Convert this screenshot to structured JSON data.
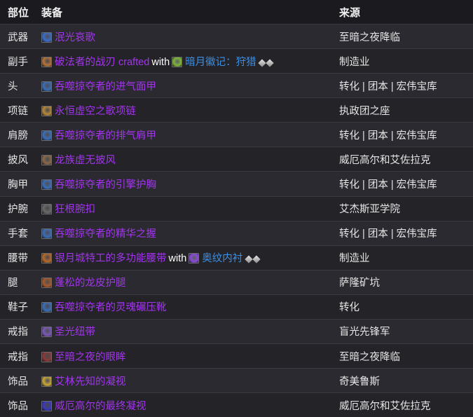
{
  "headers": {
    "slot": "部位",
    "item": "装备",
    "source": "来源"
  },
  "colors": {
    "epic": "#a335ee",
    "rare": "#3b8fe6",
    "text": "#e6e6e6"
  },
  "rows": [
    {
      "slot": "武器",
      "item": "泯光哀歌",
      "icon": "weapon-icon",
      "icon_color": "#3a6fc9",
      "source": "至暗之夜降临"
    },
    {
      "slot": "副手",
      "item": "破法者的战刃 crafted",
      "icon": "glaive-icon",
      "icon_color": "#b8743a",
      "with": "with",
      "enchant": "暗月徽记：狩猎",
      "enchant_icon": "seal-icon",
      "enchant_icon_color": "#7fb83a",
      "source": "制造业"
    },
    {
      "slot": "头",
      "item": "吞噬掠夺者的进气面甲",
      "icon": "helm-icon",
      "icon_color": "#3b6fb8",
      "source": "转化 | 团本 | 宏伟宝库"
    },
    {
      "slot": "项链",
      "item": "永恒虚空之歌项链",
      "icon": "necklace-icon",
      "icon_color": "#b88a3a",
      "source": "执政团之座"
    },
    {
      "slot": "肩膀",
      "item": "吞噬掠夺者的排气肩甲",
      "icon": "shoulder-icon",
      "icon_color": "#3b6fb8",
      "source": "转化 | 团本 | 宏伟宝库"
    },
    {
      "slot": "披风",
      "item": "龙族虚无披风",
      "icon": "cloak-icon",
      "icon_color": "#8a6a4a",
      "source": "威厄高尔和艾佐拉克"
    },
    {
      "slot": "胸甲",
      "item": "吞噬掠夺者的引擎护胸",
      "icon": "chest-icon",
      "icon_color": "#3b6fb8",
      "source": "转化 | 团本 | 宏伟宝库"
    },
    {
      "slot": "护腕",
      "item": "狂根腕扣",
      "icon": "bracer-icon",
      "icon_color": "#6a6a6a",
      "source": "艾杰斯亚学院"
    },
    {
      "slot": "手套",
      "item": "吞噬掠夺者的精华之握",
      "icon": "gloves-icon",
      "icon_color": "#3b6fb8",
      "source": "转化 | 团本 | 宏伟宝库"
    },
    {
      "slot": "腰带",
      "item": "银月城特工的多功能腰带",
      "icon": "belt-icon",
      "icon_color": "#b86a2a",
      "with": "with",
      "enchant": "奥纹内衬",
      "enchant_icon": "arcane-icon",
      "enchant_icon_color": "#8a4ad8",
      "source": "制造业"
    },
    {
      "slot": "腿",
      "item": "蓬松的龙皮护腿",
      "icon": "legs-icon",
      "icon_color": "#a85a2a",
      "source": "萨隆矿坑"
    },
    {
      "slot": "鞋子",
      "item": "吞噬掠夺者的灵魂碾压靴",
      "icon": "boots-icon",
      "icon_color": "#3b6fb8",
      "source": "转化"
    },
    {
      "slot": "戒指",
      "item": "圣光纽带",
      "icon": "ring-icon",
      "icon_color": "#7a5ab8",
      "source": "盲光先锋军"
    },
    {
      "slot": "戒指",
      "item": "至暗之夜的眼眸",
      "icon": "ring-icon",
      "icon_color": "#8a3a3a",
      "source": "至暗之夜降临"
    },
    {
      "slot": "饰品",
      "item": "艾林先知的凝视",
      "icon": "trinket-icon",
      "icon_color": "#c8a83a",
      "source": "奇美鲁斯"
    },
    {
      "slot": "饰品",
      "item": "威厄高尔的最终凝视",
      "icon": "eye-icon",
      "icon_color": "#3a3ab8",
      "source": "威厄高尔和艾佐拉克"
    }
  ]
}
